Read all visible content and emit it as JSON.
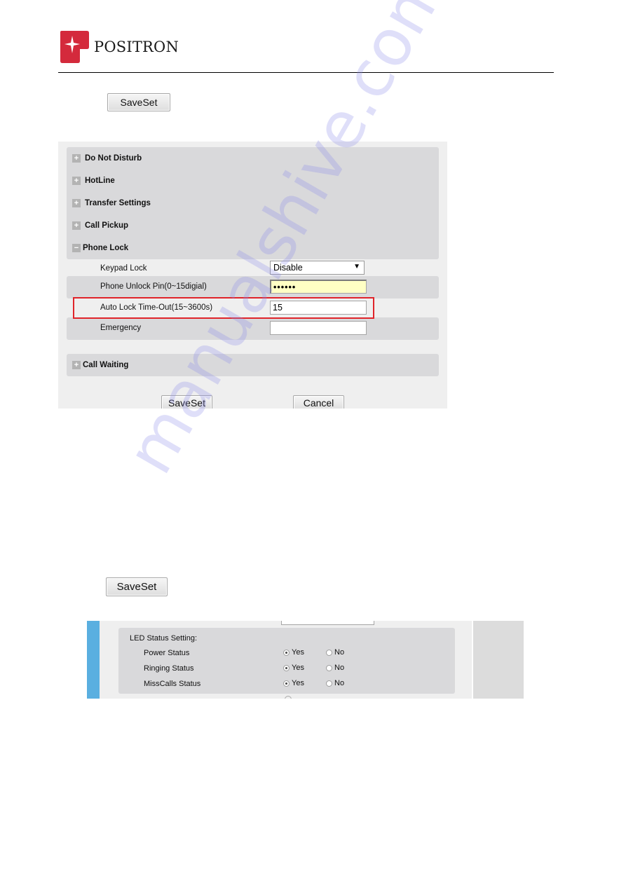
{
  "header": {
    "brand_name": "POSITRON",
    "brand_color": "#d42a3c",
    "logo_icon": "positron-p-logo-icon"
  },
  "step1": {
    "saveset_label": "SaveSet"
  },
  "screenshot1": {
    "sections": [
      {
        "label": "Do Not Disturb",
        "state": "collapsed",
        "icon": "plus-icon"
      },
      {
        "label": "HotLine",
        "state": "collapsed",
        "icon": "plus-icon"
      },
      {
        "label": "Transfer Settings",
        "state": "collapsed",
        "icon": "plus-icon"
      },
      {
        "label": "Call Pickup",
        "state": "collapsed",
        "icon": "plus-icon"
      },
      {
        "label": "Phone Lock",
        "state": "expanded",
        "icon": "minus-icon"
      }
    ],
    "phone_lock": {
      "keypad_lock": {
        "label": "Keypad Lock",
        "value": "Disable"
      },
      "unlock_pin": {
        "label": "Phone Unlock Pin(0~15digial)",
        "value": "••••••"
      },
      "auto_lock": {
        "label": "Auto Lock Time-Out(15~3600s)",
        "value": "15"
      },
      "emergency": {
        "label": "Emergency",
        "value": ""
      }
    },
    "call_waiting": {
      "label": "Call Waiting",
      "state": "collapsed",
      "icon": "plus-icon"
    },
    "buttons": {
      "save": "SaveSet",
      "cancel": "Cancel"
    },
    "highlight_color": "#e0242a"
  },
  "step2": {
    "saveset_label": "SaveSet"
  },
  "screenshot2": {
    "top_field_value": "-",
    "title": "LED Status Setting:",
    "rows": [
      {
        "label": "Power Status",
        "yes": "Yes",
        "no": "No",
        "selected": "Yes"
      },
      {
        "label": "Ringing Status",
        "yes": "Yes",
        "no": "No",
        "selected": "Yes"
      },
      {
        "label": "MissCalls Status",
        "yes": "Yes",
        "no": "No",
        "selected": "Yes"
      }
    ],
    "accent_bar_color": "#5aafe0"
  },
  "watermark": "manualshive.com"
}
